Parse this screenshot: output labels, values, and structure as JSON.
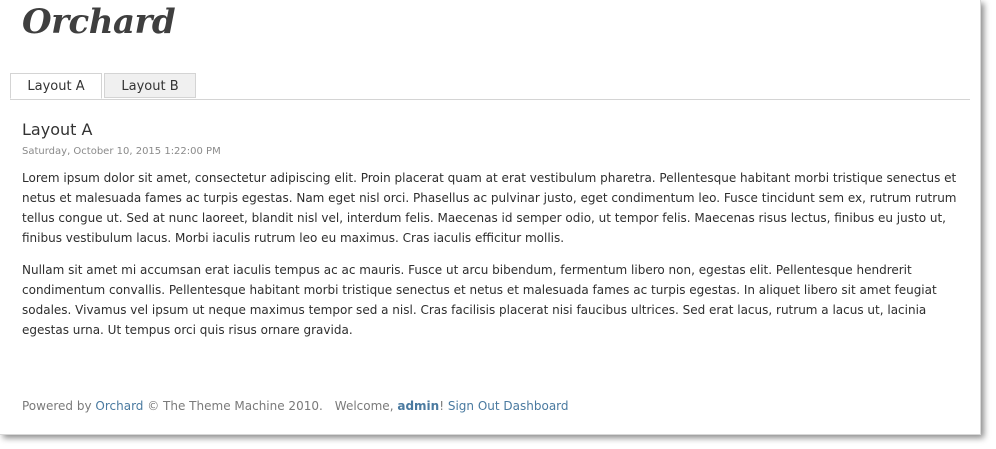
{
  "site": {
    "brand": "Orchard"
  },
  "tabs": [
    {
      "label": "Layout A",
      "active": true
    },
    {
      "label": "Layout B",
      "active": false
    }
  ],
  "page": {
    "title": "Layout A",
    "date": "Saturday, October 10, 2015 1:22:00 PM",
    "paragraphs": [
      "Lorem ipsum dolor sit amet, consectetur adipiscing elit. Proin placerat quam at erat vestibulum pharetra. Pellentesque habitant morbi tristique senectus et netus et malesuada fames ac turpis egestas. Nam eget nisl orci. Phasellus ac pulvinar justo, eget condimentum leo. Fusce tincidunt sem ex, rutrum rutrum tellus congue ut. Sed at nunc laoreet, blandit nisl vel, interdum felis. Maecenas id semper odio, ut tempor felis. Maecenas risus lectus, finibus eu justo ut, finibus vestibulum lacus. Morbi iaculis rutrum leo eu maximus. Cras iaculis efficitur mollis.",
      "Nullam sit amet mi accumsan erat iaculis tempus ac ac mauris. Fusce ut arcu bibendum, fermentum libero non, egestas elit. Pellentesque hendrerit condimentum convallis. Pellentesque habitant morbi tristique senectus et netus et malesuada fames ac turpis egestas. In aliquet libero sit amet feugiat sodales. Vivamus vel ipsum ut neque maximus tempor sed a nisl. Cras facilisis placerat nisi faucibus ultrices. Sed erat lacus, rutrum a lacus ut, lacinia egestas urna. Ut tempus orci quis risus ornare gravida."
    ]
  },
  "footer": {
    "powered_by": "Powered by",
    "orchard_link": "Orchard",
    "copyright": "© The Theme Machine 2010.",
    "welcome": "Welcome,",
    "user": "admin",
    "exclaim": "!",
    "sign_out": "Sign Out",
    "dashboard": "Dashboard"
  },
  "colors": {
    "link": "#4a7aa0",
    "text": "#2e2e2e",
    "muted": "#8a8a8a",
    "tab_border": "#d4d4d4",
    "tab_inactive_bg": "#f0f0f0"
  }
}
